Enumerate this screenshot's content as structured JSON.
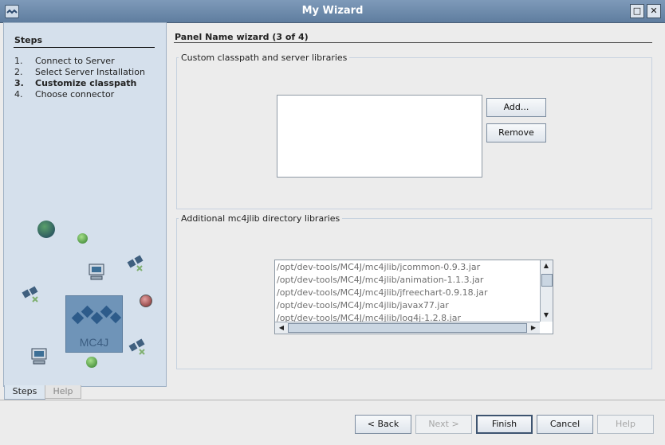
{
  "window": {
    "title": "My Wizard"
  },
  "sidebar": {
    "title": "Steps",
    "steps": [
      {
        "num": "1.",
        "label": "Connect to Server",
        "active": false
      },
      {
        "num": "2.",
        "label": "Select Server Installation",
        "active": false
      },
      {
        "num": "3.",
        "label": "Customize classpath",
        "active": true
      },
      {
        "num": "4.",
        "label": "Choose connector",
        "active": false
      }
    ],
    "logo_text": "MC4J",
    "tabs": [
      "Steps",
      "Help"
    ]
  },
  "panel": {
    "title": "Panel Name wizard (3 of 4)",
    "custom_group": {
      "label": "Custom classpath and server libraries",
      "add_label": "Add...",
      "remove_label": "Remove"
    },
    "additional_group": {
      "label": "Additional mc4jlib directory libraries",
      "items": [
        "/opt/dev-tools/MC4J/mc4jlib/jcommon-0.9.3.jar",
        "/opt/dev-tools/MC4J/mc4jlib/animation-1.1.3.jar",
        "/opt/dev-tools/MC4J/mc4jlib/jfreechart-0.9.18.jar",
        "/opt/dev-tools/MC4J/mc4jlib/javax77.jar",
        "/opt/dev-tools/MC4J/mc4jlib/log4j-1.2.8.jar"
      ]
    }
  },
  "footer": {
    "back": "< Back",
    "next": "Next >",
    "finish": "Finish",
    "cancel": "Cancel",
    "help": "Help"
  },
  "colors": {
    "titlebar": "#6f8cad",
    "sidebar": "#d5e0ec",
    "logo_bg": "#6f94b8"
  }
}
